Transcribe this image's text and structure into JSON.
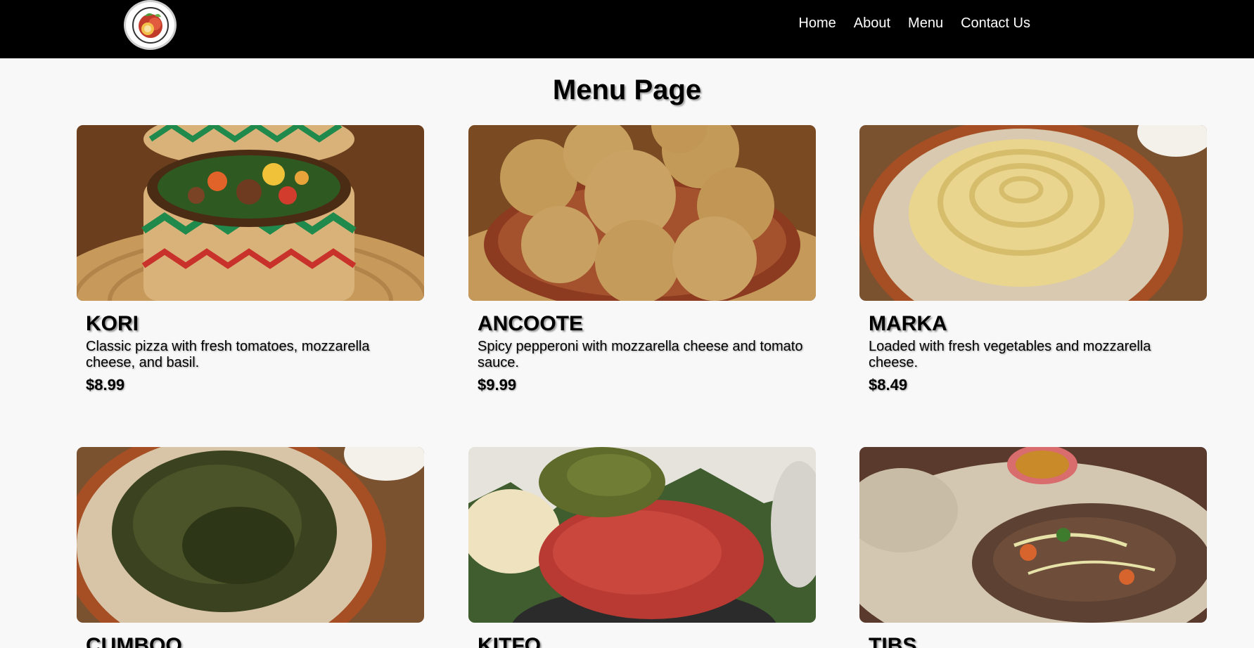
{
  "nav": {
    "logo_icon": "plate-logo-icon",
    "links": [
      "Home",
      "About",
      "Menu",
      "Contact Us"
    ]
  },
  "page": {
    "title": "Menu Page"
  },
  "menu": [
    {
      "name": "KORI",
      "description": "Classic pizza with fresh tomatoes, mozzarella cheese, and basil.",
      "price": "$8.99",
      "image": "stew-in-woven-basket-image"
    },
    {
      "name": "ANCOOTE",
      "description": "Spicy pepperoni with mozzarella cheese and tomato sauce.",
      "price": "$9.99",
      "image": "dough-balls-bowl-image"
    },
    {
      "name": "MARKA",
      "description": "Loaded with fresh vegetables and mozzarella cheese.",
      "price": "$8.49",
      "image": "porridge-swirl-plate-image"
    },
    {
      "name": "CUMBOO",
      "description": "",
      "price": "",
      "image": "minced-greens-plate-image"
    },
    {
      "name": "KITFO",
      "description": "",
      "price": "",
      "image": "minced-meat-with-greens-image"
    },
    {
      "name": "TIBS",
      "description": "",
      "price": "",
      "image": "sauteed-meat-on-injera-image"
    }
  ],
  "colors": {
    "navbar": "#000000",
    "background": "#f8f8f8",
    "text": "#000000",
    "nav_text": "#ffffff"
  }
}
